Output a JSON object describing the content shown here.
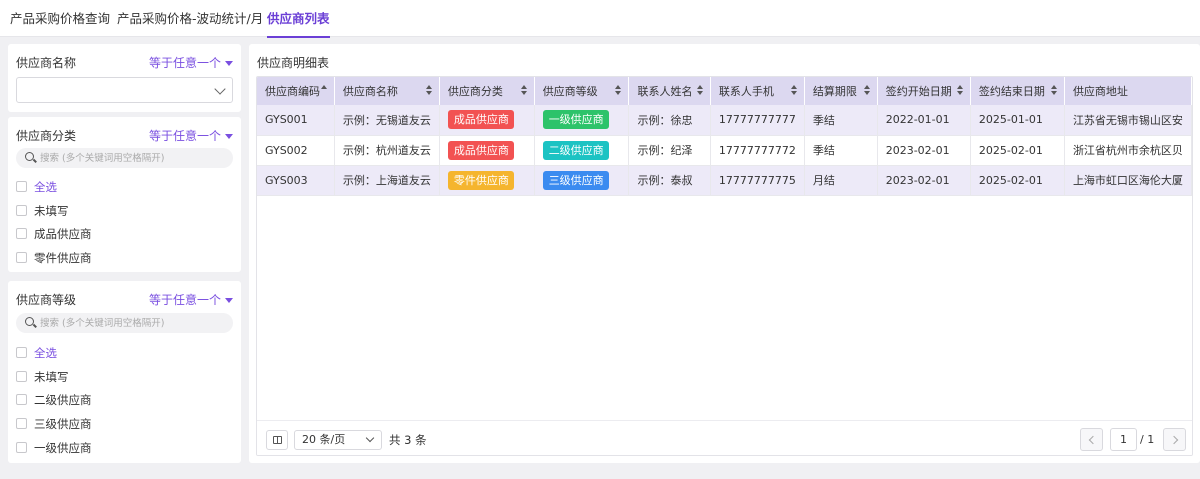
{
  "tabs": [
    {
      "label": "产品采购价格查询",
      "active": false
    },
    {
      "label": "产品采购价格-波动统计/月",
      "active": false
    },
    {
      "label": "供应商列表",
      "active": true
    }
  ],
  "filters": {
    "name": {
      "title": "供应商名称",
      "operator": "等于任意一个",
      "value": ""
    },
    "category": {
      "title": "供应商分类",
      "operator": "等于任意一个",
      "search_placeholder": "搜索 (多个关键词用空格隔开)",
      "options": [
        "全选",
        "未填写",
        "成品供应商",
        "零件供应商"
      ]
    },
    "level": {
      "title": "供应商等级",
      "operator": "等于任意一个",
      "search_placeholder": "搜索 (多个关键词用空格隔开)",
      "options": [
        "全选",
        "未填写",
        "二级供应商",
        "三级供应商",
        "一级供应商"
      ]
    }
  },
  "table": {
    "title": "供应商明细表",
    "columns": [
      "供应商编码",
      "供应商名称",
      "供应商分类",
      "供应商等级",
      "联系人姓名",
      "联系人手机",
      "结算期限",
      "签约开始日期",
      "签约结束日期",
      "供应商地址"
    ],
    "rows": [
      {
        "code": "GYS001",
        "name": "示例：无锡道友云",
        "category": "成品供应商",
        "category_color": "#f25252",
        "level": "一级供应商",
        "level_color": "#2dc36a",
        "contact": "示例：徐忠",
        "phone": "17777777777",
        "term": "季结",
        "start": "2022-01-01",
        "end": "2025-01-01",
        "address": "江苏省无锡市锡山区安"
      },
      {
        "code": "GYS002",
        "name": "示例：杭州道友云",
        "category": "成品供应商",
        "category_color": "#f25252",
        "level": "二级供应商",
        "level_color": "#1cc3c3",
        "contact": "示例：纪泽",
        "phone": "17777777772",
        "term": "季结",
        "start": "2023-02-01",
        "end": "2025-02-01",
        "address": "浙江省杭州市余杭区贝"
      },
      {
        "code": "GYS003",
        "name": "示例：上海道友云",
        "category": "零件供应商",
        "category_color": "#f5b52e",
        "level": "三级供应商",
        "level_color": "#3b8bf0",
        "contact": "示例：泰叔",
        "phone": "17777777775",
        "term": "月结",
        "start": "2023-02-01",
        "end": "2025-02-01",
        "address": "上海市虹口区海伦大厦"
      }
    ]
  },
  "pagination": {
    "page_size": "20 条/页",
    "total": "共 3 条",
    "current": "1",
    "of": "/ 1"
  }
}
